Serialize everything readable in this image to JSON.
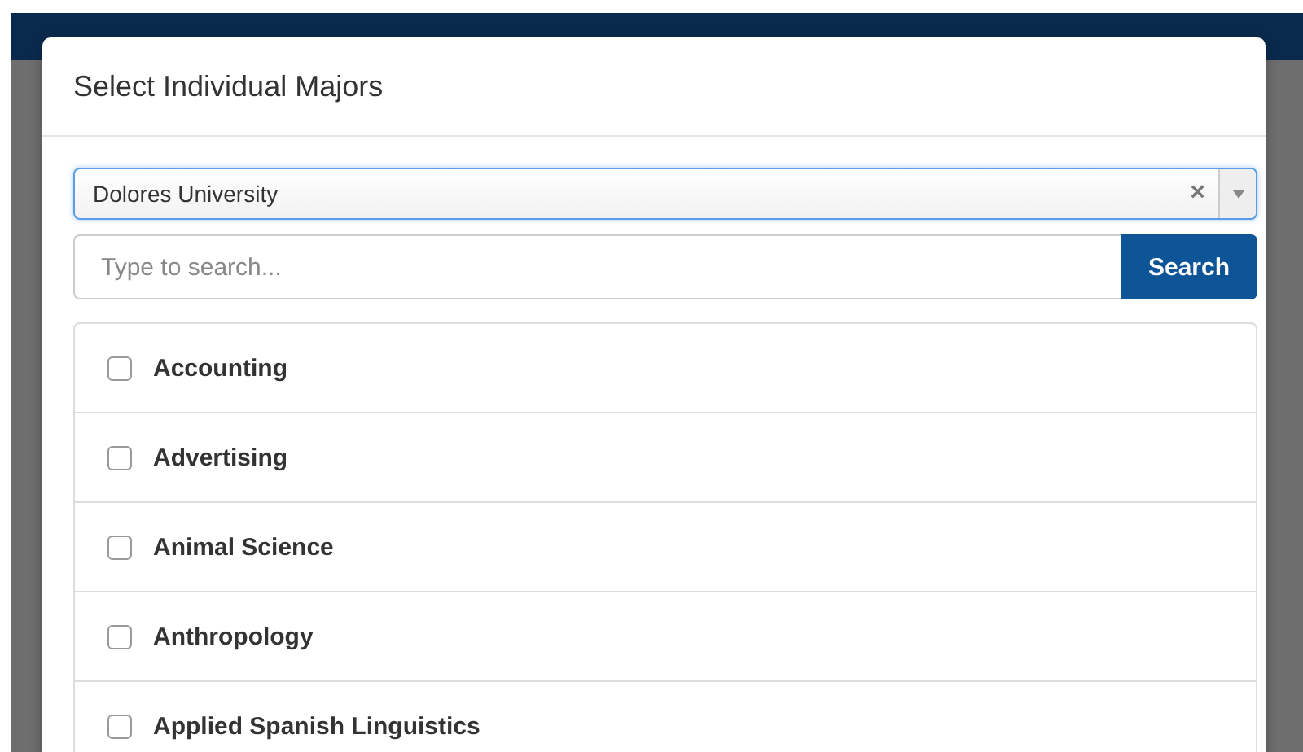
{
  "dialog": {
    "title": "Select Individual Majors"
  },
  "university_select": {
    "value": "Dolores University",
    "clear": "×"
  },
  "search": {
    "placeholder": "Type to search...",
    "button": "Search"
  },
  "majors": [
    {
      "name": "Accounting",
      "checked": false
    },
    {
      "name": "Advertising",
      "checked": false
    },
    {
      "name": "Animal Science",
      "checked": false
    },
    {
      "name": "Anthropology",
      "checked": false
    },
    {
      "name": "Applied Spanish Linguistics",
      "checked": false
    }
  ]
}
